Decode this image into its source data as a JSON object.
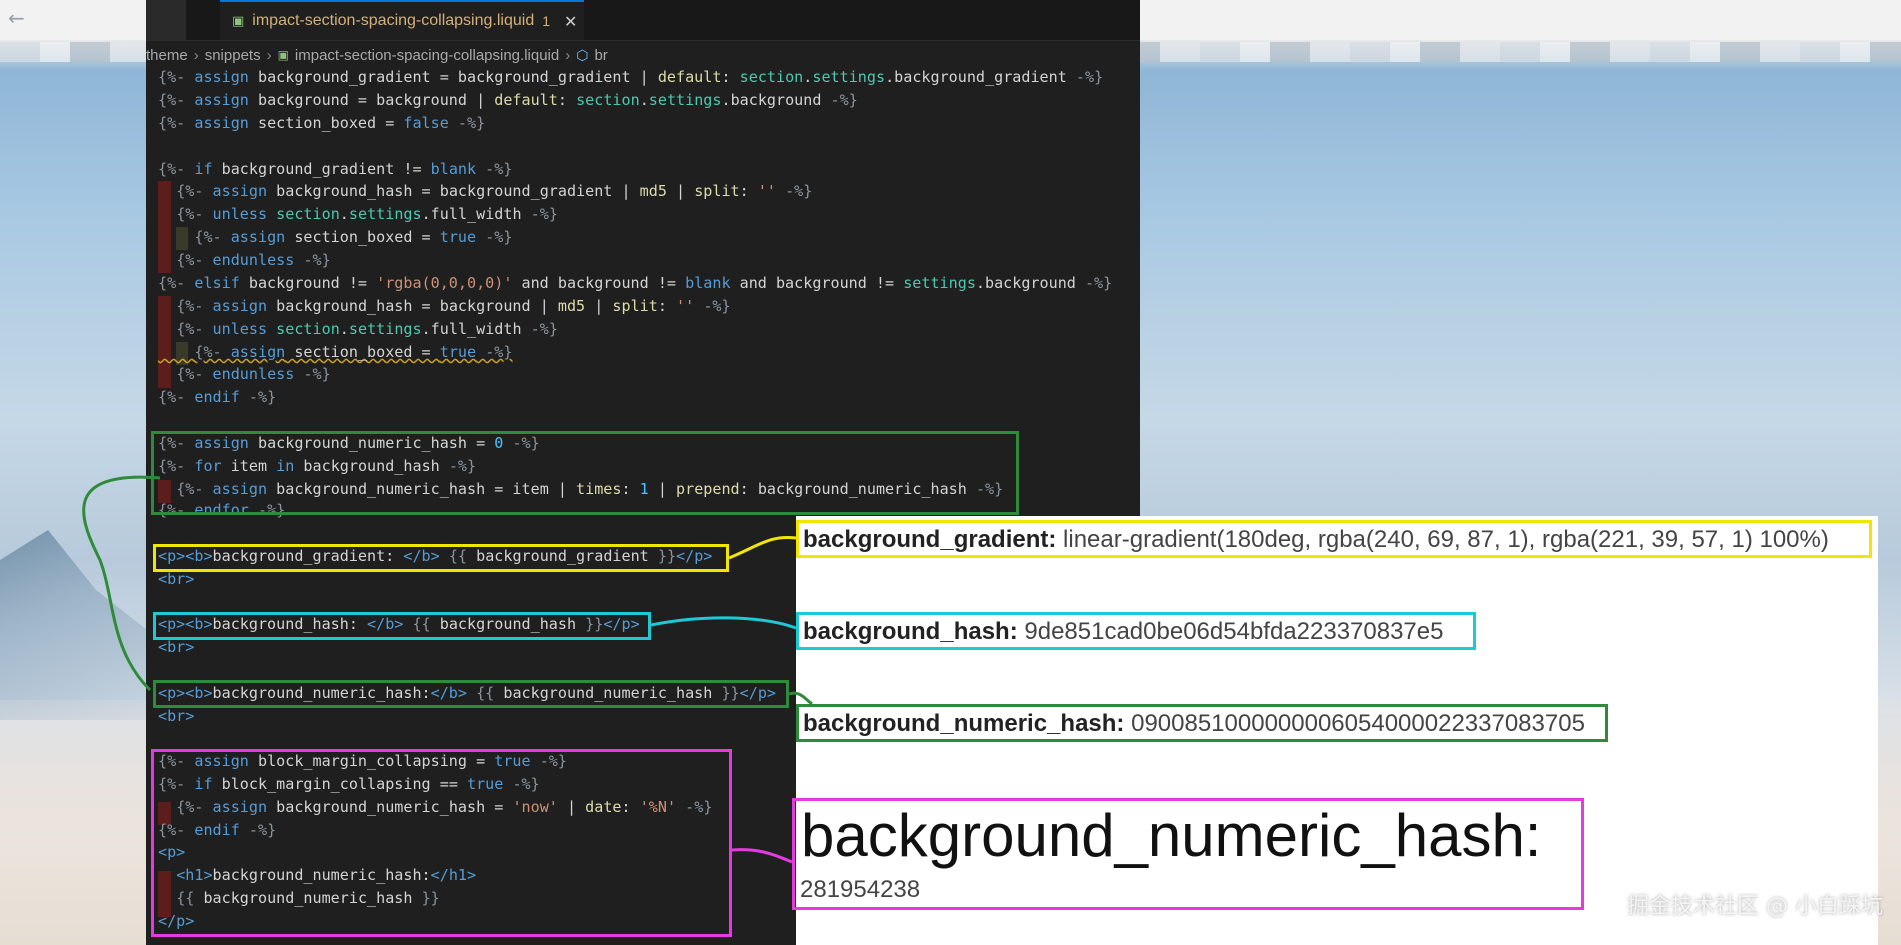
{
  "editor": {
    "tab": {
      "title": "impact-section-spacing-collapsing.liquid",
      "problems": "1",
      "close": "✕"
    },
    "breadcrumb": [
      "theme",
      "snippets",
      "impact-section-spacing-collapsing.liquid",
      "br"
    ],
    "lines": [
      "{%- assign background_gradient = background_gradient | default: section.settings.background_gradient -%}",
      "{%- assign background = background | default: section.settings.background -%}",
      "{%- assign section_boxed = false -%}",
      "",
      "{%- if background_gradient != blank -%}",
      "  {%- assign background_hash = background_gradient | md5 | split: '' -%}",
      "  {%- unless section.settings.full_width -%}",
      "    {%- assign section_boxed = true -%}",
      "  {%- endunless -%}",
      "{%- elsif background != 'rgba(0,0,0,0)' and background != blank and background != settings.background -%}",
      "  {%- assign background_hash = background | md5 | split: '' -%}",
      "  {%- unless section.settings.full_width -%}",
      "    {%- assign section_boxed = true -%}",
      "  {%- endunless -%}",
      "{%- endif -%}",
      "",
      "{%- assign background_numeric_hash = 0 -%}",
      "{%- for item in background_hash -%}",
      "  {%- assign background_numeric_hash = item | times: 1 | prepend: background_numeric_hash -%}",
      "{%- endfor -%}",
      "<p><b>background_gradient: </b> {{ background_gradient }}</p>",
      "<br>",
      "",
      "<p><b>background_hash: </b> {{ background_hash }}</p>",
      "<br>",
      "",
      "<p><b>background_numeric_hash:</b> {{ background_numeric_hash }}</p>",
      "<br>",
      "",
      "{%- assign block_margin_collapsing = true -%}",
      "{%- if block_margin_collapsing == true -%}",
      "  {%- assign background_numeric_hash = 'now' | date: '%N' -%}",
      "{%- endif -%}",
      "<p>",
      "  <h1>background_numeric_hash:</h1>",
      "  {{ background_numeric_hash }}",
      "</p>"
    ]
  },
  "preview": {
    "gradient_label": "background_gradient:",
    "gradient_value": "linear-gradient(180deg, rgba(240, 69, 87, 1), rgba(221, 39, 57, 1) 100%)",
    "hash_label": "background_hash:",
    "hash_value": "9de851cad0be06d54bfda223370837e5",
    "numeric_label": "background_numeric_hash:",
    "numeric_value": "0900851000000006054000022337083705",
    "h1_label": "background_numeric_hash:",
    "h1_value": "281954238"
  },
  "watermark": "掘金技术社区 @ 小白踩坑",
  "colors": {
    "annotation_green": "#2e8b3a",
    "annotation_yellow": "#f2e600",
    "annotation_cyan": "#1ec9d6",
    "annotation_magenta": "#e23be0",
    "editor_bg": "#1f1f1f",
    "tab_accent": "#0078d4"
  },
  "icons": [
    "liquid-file-icon",
    "symbol-icon",
    "close-icon",
    "back-arrow-icon"
  ]
}
